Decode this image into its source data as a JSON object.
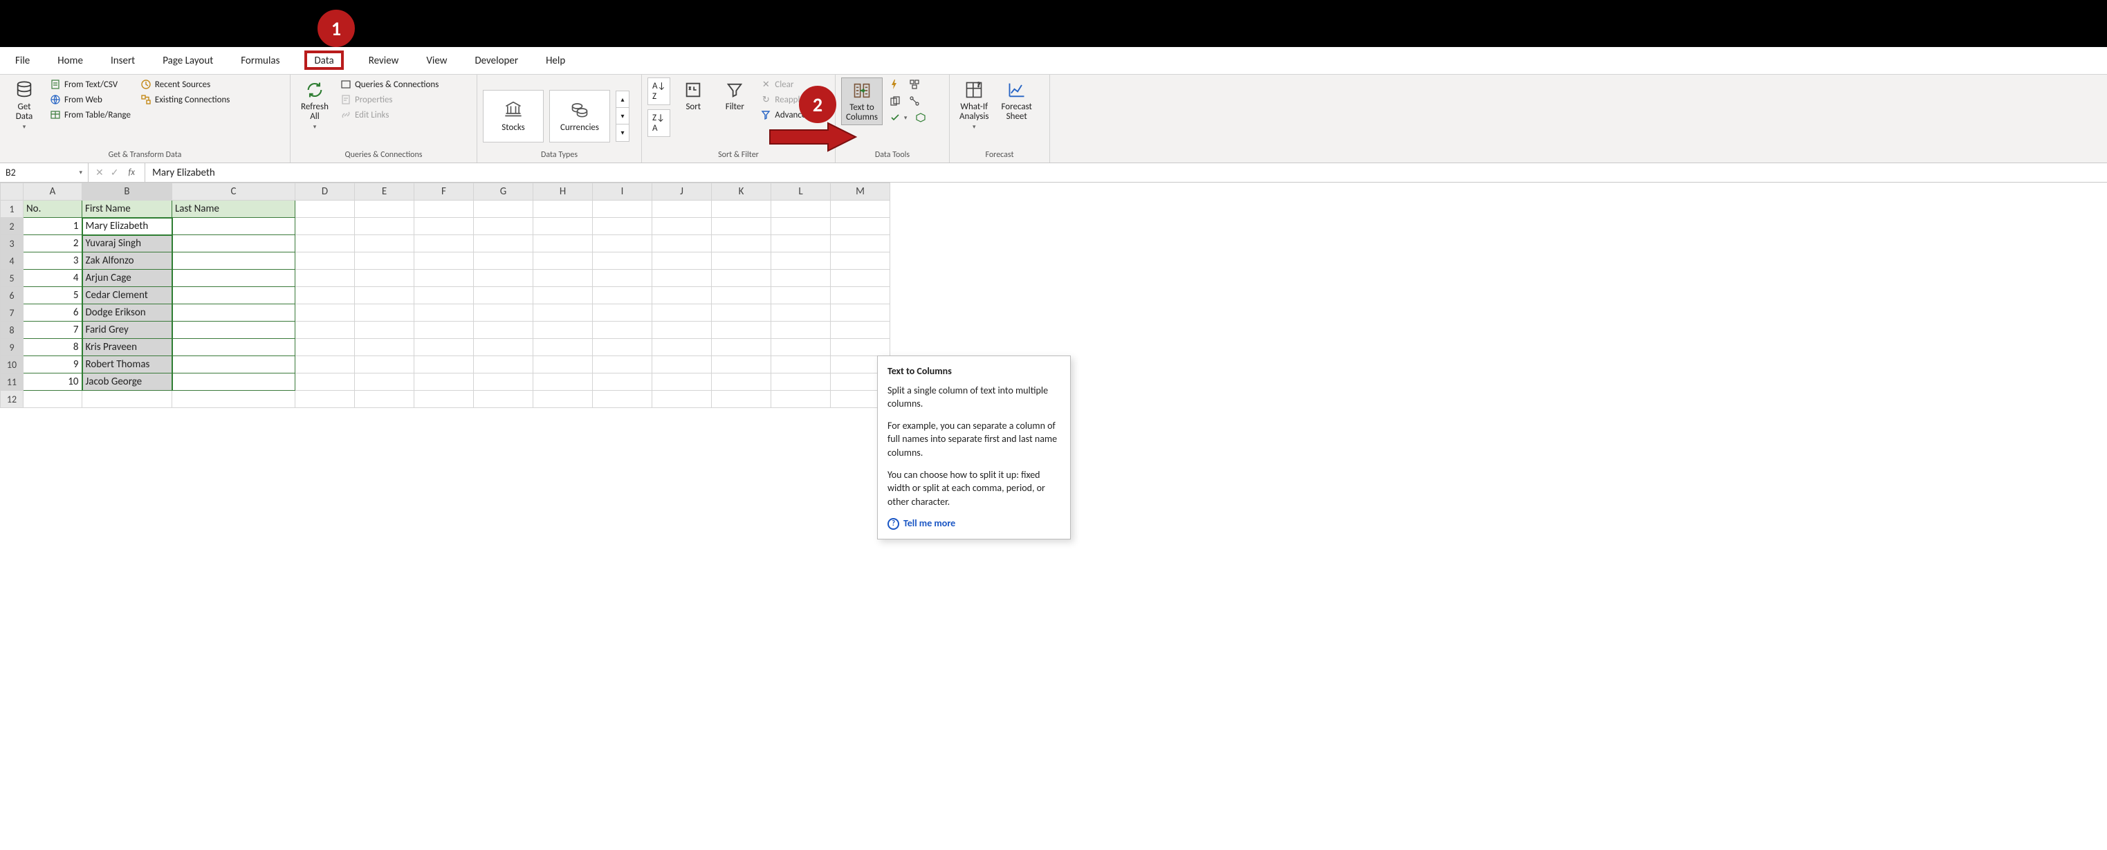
{
  "steps": {
    "s1": "1",
    "s2": "2"
  },
  "tabs": {
    "file": "File",
    "home": "Home",
    "insert": "Insert",
    "pagelayout": "Page Layout",
    "formulas": "Formulas",
    "data": "Data",
    "review": "Review",
    "view": "View",
    "developer": "Developer",
    "help": "Help"
  },
  "ribbon": {
    "get_data": "Get\nData",
    "from_csv": "From Text/CSV",
    "from_web": "From Web",
    "from_table": "From Table/Range",
    "recent": "Recent Sources",
    "existing": "Existing Connections",
    "g1": "Get & Transform Data",
    "refresh": "Refresh\nAll",
    "queries": "Queries & Connections",
    "props": "Properties",
    "links": "Edit Links",
    "g2": "Queries & Connections",
    "stocks": "Stocks",
    "currencies": "Currencies",
    "g3": "Data Types",
    "sort": "Sort",
    "filter": "Filter",
    "clear": "Clear",
    "reapply": "Reapply",
    "advanced": "Advanced",
    "g4": "Sort & Filter",
    "t2c": "Text to\nColumns",
    "g5": "Data Tools",
    "whatif": "What-If\nAnalysis",
    "forecast": "Forecast\nSheet",
    "g6": "Forecast"
  },
  "formula": {
    "ref": "B2",
    "fx": "fx",
    "value": "Mary Elizabeth"
  },
  "columns": [
    "A",
    "B",
    "C",
    "D",
    "E",
    "F",
    "G",
    "H",
    "I",
    "J",
    "K",
    "L",
    "M"
  ],
  "headers": {
    "a": "No.",
    "b": "First Name",
    "c": "Last Name"
  },
  "rows": [
    {
      "n": "1",
      "fn": "Mary Elizabeth",
      "ln": ""
    },
    {
      "n": "2",
      "fn": "Yuvaraj Singh",
      "ln": ""
    },
    {
      "n": "3",
      "fn": "Zak Alfonzo",
      "ln": ""
    },
    {
      "n": "4",
      "fn": "Arjun Cage",
      "ln": ""
    },
    {
      "n": "5",
      "fn": "Cedar Clement",
      "ln": ""
    },
    {
      "n": "6",
      "fn": "Dodge Erikson",
      "ln": ""
    },
    {
      "n": "7",
      "fn": "Farid Grey",
      "ln": ""
    },
    {
      "n": "8",
      "fn": "Kris Praveen",
      "ln": ""
    },
    {
      "n": "9",
      "fn": "Robert Thomas",
      "ln": ""
    },
    {
      "n": "10",
      "fn": "Jacob George",
      "ln": ""
    }
  ],
  "tooltip": {
    "title": "Text to Columns",
    "p1": "Split a single column of text into multiple columns.",
    "p2": "For example, you can separate a column of full names into separate first and last name columns.",
    "p3": "You can choose how to split it up: fixed width or split at each comma, period, or other character.",
    "more": "Tell me more"
  }
}
